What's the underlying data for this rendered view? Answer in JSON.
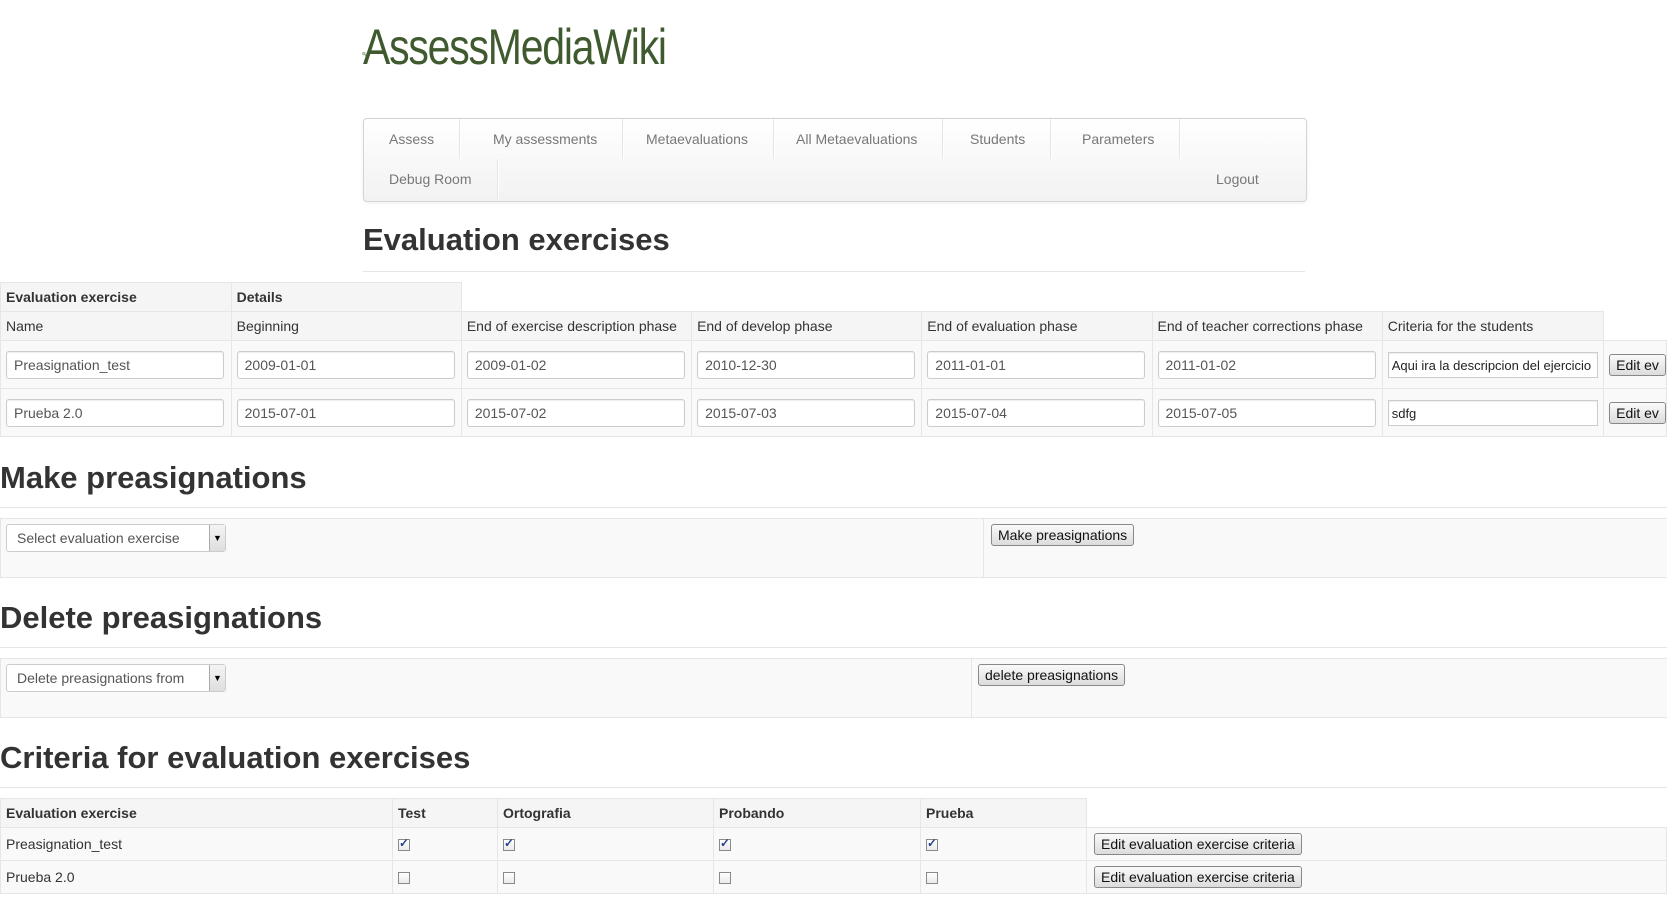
{
  "app": {
    "logo_text": "AssessMediaWiki"
  },
  "nav": {
    "items": [
      "Assess",
      "My assessments",
      "Metaevaluations",
      "All Metaevaluations",
      "Students",
      "Parameters",
      "Debug Room"
    ],
    "logout": "Logout"
  },
  "exercises": {
    "title": "Evaluation exercises",
    "group_headers": [
      "Evaluation exercise",
      "Details"
    ],
    "columns": [
      "Name",
      "Beginning",
      "End of exercise description phase",
      "End of develop phase",
      "End of evaluation phase",
      "End of teacher corrections phase",
      "Criteria for the students"
    ],
    "edit_label": "Edit ev",
    "rows": [
      {
        "name": "Preasignation_test",
        "beginning": "2009-01-01",
        "desc_end": "2009-01-02",
        "develop_end": "2010-12-30",
        "eval_end": "2011-01-01",
        "teacher_end": "2011-01-02",
        "criteria": "Aqui ira la descripcion del ejercicio"
      },
      {
        "name": "Prueba 2.0",
        "beginning": "2015-07-01",
        "desc_end": "2015-07-02",
        "develop_end": "2015-07-03",
        "eval_end": "2015-07-04",
        "teacher_end": "2015-07-05",
        "criteria": "sdfg"
      }
    ]
  },
  "make_preasign": {
    "title": "Make preasignations",
    "select_value": "Select evaluation exercise",
    "button": "Make preasignations"
  },
  "delete_preasign": {
    "title": "Delete preasignations",
    "select_value": "Delete preasignations from",
    "button": "delete preasignations"
  },
  "criteria": {
    "title": "Criteria for evaluation exercises",
    "columns": [
      "Evaluation exercise",
      "Test",
      "Ortografia",
      "Probando",
      "Prueba"
    ],
    "button": "Edit evaluation exercise criteria",
    "rows": [
      {
        "name": "Preasignation_test",
        "checks": [
          true,
          true,
          true,
          true
        ]
      },
      {
        "name": "Prueba 2.0",
        "checks": [
          false,
          false,
          false,
          false
        ]
      }
    ]
  },
  "colors": {
    "logo_green": "#4a6b3a",
    "text": "#333333",
    "nav_text": "#777777"
  }
}
